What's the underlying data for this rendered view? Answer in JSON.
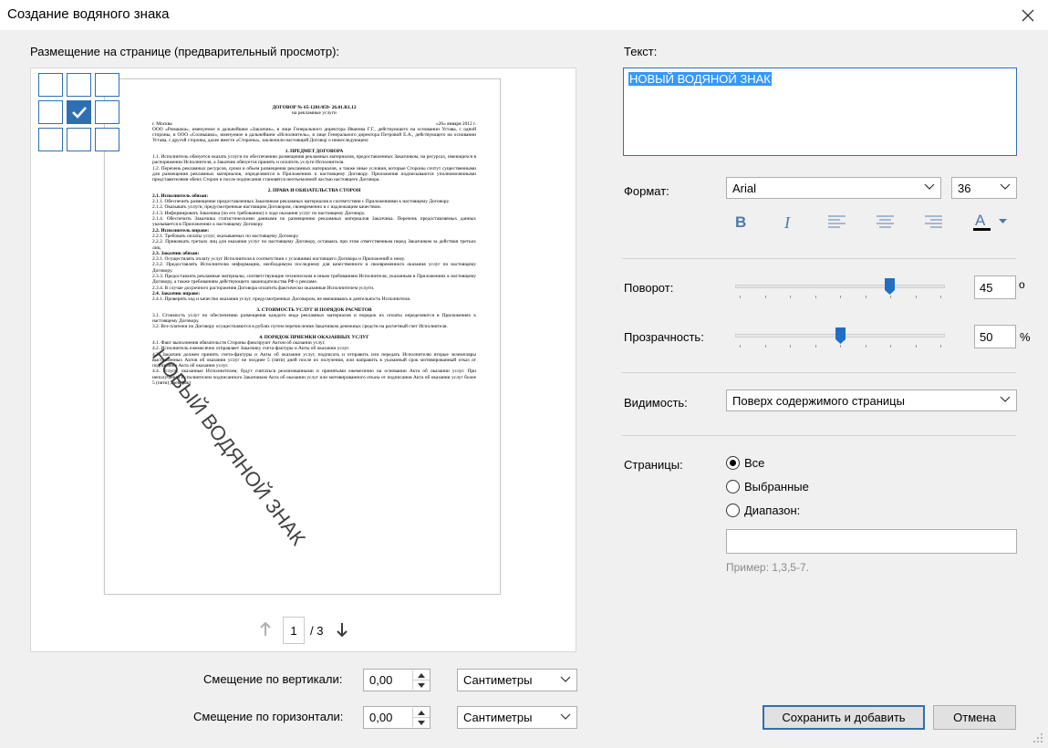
{
  "window": {
    "title": "Создание водяного знака"
  },
  "preview": {
    "label": "Размещение на странице (предварительный просмотр):",
    "page_current": "1",
    "page_total": "/ 3",
    "watermark_text": "НОВЫЙ ВОДЯНОЙ ЗНАК"
  },
  "document": {
    "title1": "ДОГОВОР № 65-1201/059- 26.01.R1.12",
    "title2": "на рекламные услуги",
    "city": "г. Москва",
    "date": "«26» января 2012 г.",
    "intro": "ООО «Ромашка», именуемое в дальнейшем «Заказчик», в лице Генерального директора Иванова Г.Г., действующего на основании Устава, с одной стороны, и ООО «Солнышко», именуемое в дальнейшем «Исполнитель», в лице Генерального директора Петровой Е.А., действующего на основании Устава, с другой стороны, далее вместе «Стороны», заключили настоящий Договор о нижеследующем:",
    "sec1": "1.          ПРЕДМЕТ ДОГОВОРА",
    "p11": "1.1. Исполнитель обязуется оказать услуги по обеспечению размещения рекламных материалов, предоставленных Заказчиком, на ресурсах, имеющихся в распоряжении Исполнителя, а Заказчик обязуется принять и оплатить услуги Исполнителя.",
    "p12": "1.2. Перечень рекламных ресурсов, сроки и объем размещения рекламных материалов, а также иные условия, которые Стороны сочтут существенными для размещения рекламных материалов, определяются в Приложениях к настоящему Договору. Приложения подписываются уполномоченными представителями обеих Сторон и после подписания становятся неотъемлемой частью настоящего Договора.",
    "sec2": "2.          ПРАВА И ОБЯЗАТЕЛЬСТВА СТОРОН",
    "p21": "2.1. Исполнитель обязан:",
    "p211": "2.1.1. Обеспечить размещение предоставленных Заказчиком рекламных материалов в соответствии с Приложениями к настоящему Договору.",
    "p212": "2.1.2. Оказывать услуги, предусмотренные настоящим Договором, своевременно и с надлежащим качеством.",
    "p213": "2.1.3. Информировать Заказчика (по его требованию) о ходе оказания услуг по настоящему Договору.",
    "p214": "2.1.4. Обеспечить Заказчика статистическими данными по размещению рекламных материалов Заказчика. Перечень предоставляемых данных указывается в Приложениях к настоящему Договору.",
    "p22": "2.2. Исполнитель вправе:",
    "p221": "2.2.1. Требовать оплаты услуг, оказываемых по настоящему Договору.",
    "p222": "2.2.2. Привлекать третьих лиц для оказания услуг по настоящему Договору, оставаясь при этом ответственным перед Заказчиком за действия третьих лиц.",
    "p23": "2.3. Заказчик обязан:",
    "p231": "2.3.1. Осуществлять оплату услуг Исполнителя в соответствии с условиями настоящего Договора и Приложений к нему.",
    "p232": "2.3.2. Предоставлять Исполнителю информацию, необходимую последнему для качественного и своевременного оказания услуг по настоящему Договору.",
    "p233": "2.3.3. Предоставлять рекламные материалы, соответствующие техническим и иным требованиям Исполнителя, указанным в Приложениях к настоящему Договору, а также требованиям действующего законодательства РФ о рекламе.",
    "p234": "2.3.4. В случае досрочного расторжения Договора оплатить фактически оказанные Исполнителем услуги.",
    "p24": "2.4. Заказчик вправе:",
    "p241": "2.4.1. Проверять ход и качество оказания услуг, предусмотренных Договором, не вмешиваясь в деятельность Исполнителя.",
    "sec3": "3.          СТОИМОСТЬ УСЛУГ И ПОРЯДОК РАСЧЕТОВ",
    "p31": "3.1. Стоимость услуг по обеспечению размещения каждого вида рекламных материалов и порядок их оплаты определяются в Приложениях к настоящему Договору.",
    "p32": "3.2. Все платежи по Договору осуществляются в рублях путем перечисления Заказчиком денежных средств на расчетный счет Исполнителя.",
    "sec4": "4.          ПОРЯДОК ПРИЕМКИ ОКАЗАННЫХ УСЛУГ",
    "p41": "4.1. Факт выполнения обязательств Стороны фиксируют Актом об оказании услуг.",
    "p42": "4.2. Исполнитель ежемесячно отправляет Заказчику счета-фактуры и Акты об оказании услуг.",
    "p43": "4.3. Заказчик должен принять счета-фактуры и Акты об оказании услуг, подписать и отправить или передать Исполнителю вторые экземпляры выставленных Актов об оказании услуг не позднее 5 (пяти) дней после их получения, или направить в указанный срок мотивированный отказ от подписания Акта об оказании услуг.",
    "p44": "4.4. Услуги, оказанные Исполнителем, будут считаться реализованными и принятыми ежемесячно на основании Акта об оказании услуг. При неполучении Исполнителем подписанного Заказчиком Акта об оказании услуг или мотивированного отказа от подписания Акта об оказании услуг более 5 (пяти) дней факт"
  },
  "offsets": {
    "vertical_label": "Смещение по вертикали:",
    "vertical_value": "0,00",
    "vertical_unit": "Сантиметры",
    "horizontal_label": "Смещение по горизонтали:",
    "horizontal_value": "0,00",
    "horizontal_unit": "Сантиметры"
  },
  "text": {
    "label": "Текст:",
    "value": "НОВЫЙ ВОДЯНОЙ ЗНАК",
    "selection_color": "#3399ff"
  },
  "format": {
    "label": "Формат:",
    "font": "Arial",
    "size": "36",
    "bold": "B",
    "italic": "I",
    "text_color_glyph": "A"
  },
  "rotation": {
    "label": "Поворот:",
    "value": "45",
    "unit": "о",
    "level": 0.75
  },
  "opacity": {
    "label": "Прозрачность:",
    "value": "50",
    "unit": "%",
    "level": 0.5
  },
  "visibility": {
    "label": "Видимость:",
    "value": "Поверх содержимого страницы"
  },
  "pages": {
    "label": "Страницы:",
    "options": [
      "Все",
      "Выбранные",
      "Диапазон:"
    ],
    "selected": 0,
    "range_value": "",
    "hint": "Пример: 1,3,5-7."
  },
  "buttons": {
    "save": "Сохранить и добавить",
    "cancel": "Отмена"
  },
  "colors": {
    "accent": "#2e6fb4",
    "format_icons": "#4d79a8",
    "thumb": "#1f6fc5"
  }
}
